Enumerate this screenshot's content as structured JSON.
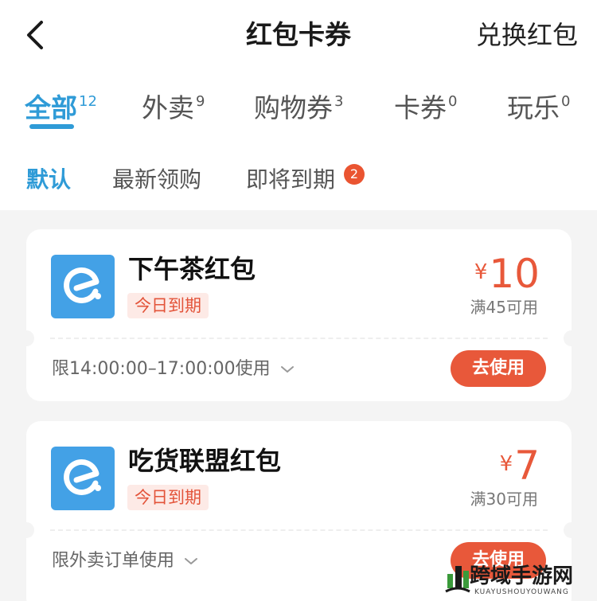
{
  "header": {
    "title": "红包卡券",
    "exchange_label": "兑换红包"
  },
  "tabs": [
    {
      "label": "全部",
      "count": "12"
    },
    {
      "label": "外卖",
      "count": "9"
    },
    {
      "label": "购物券",
      "count": "3"
    },
    {
      "label": "卡券",
      "count": "0"
    },
    {
      "label": "玩乐",
      "count": "0"
    }
  ],
  "subtabs": [
    {
      "label": "默认"
    },
    {
      "label": "最新领购"
    },
    {
      "label": "即将到期",
      "badge": "2"
    }
  ],
  "coupons": [
    {
      "name": "下午茶红包",
      "tag": "今日到期",
      "currency": "¥",
      "amount": "10",
      "condition": "满45可用",
      "limit": "限14:00:00–17:00:00使用",
      "button": "去使用"
    },
    {
      "name": "吃货联盟红包",
      "tag": "今日到期",
      "currency": "¥",
      "amount": "7",
      "condition": "满30可用",
      "limit": "限外卖订单使用",
      "button": "去使用"
    }
  ],
  "watermark": {
    "title": "跨域手游网",
    "subtitle": "KUAYUSHOUYOUWANG"
  },
  "colors": {
    "accent_blue": "#2f9bd7",
    "accent_red": "#e8583a",
    "logo_blue": "#43a1e6"
  },
  "icons": [
    "back-arrow-icon",
    "chevron-down-icon",
    "eleme-logo-icon"
  ]
}
